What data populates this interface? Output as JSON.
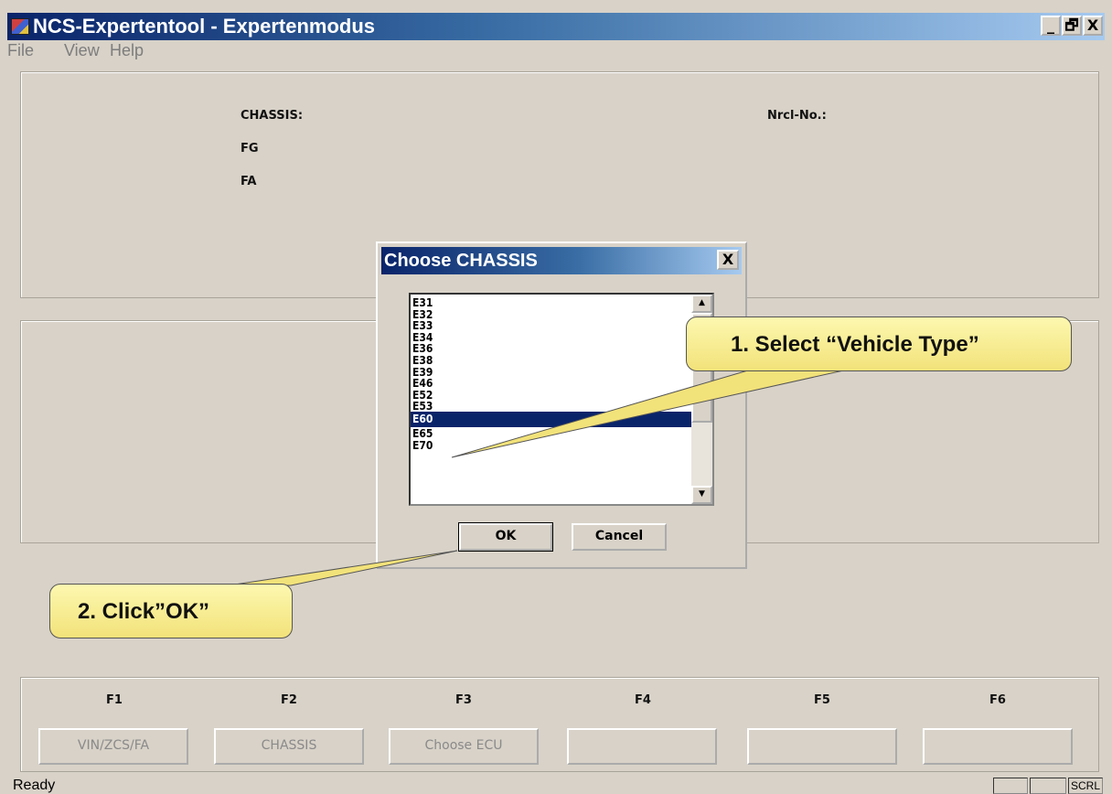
{
  "window": {
    "title": "NCS-Expertentool - Expertenmodus",
    "minimize": "_",
    "restore": "🗗",
    "close": "X"
  },
  "menu": {
    "file": "File",
    "view": "View",
    "help": "Help"
  },
  "info_panel": {
    "chassis_label": "CHASSIS:",
    "fg_label": "FG",
    "fa_label": "FA",
    "nrcl_label": "Nrcl-No.:"
  },
  "dialog": {
    "title": "Choose CHASSIS",
    "close": "X",
    "items": [
      "E31",
      "E32",
      "E33",
      "E34",
      "E36",
      "E38",
      "E39",
      "E46",
      "E52",
      "E53",
      "E60",
      "E65",
      "E70"
    ],
    "selected_item": "E60",
    "ok_label": "OK",
    "cancel_label": "Cancel",
    "scroll_up": "▲",
    "scroll_down": "▼"
  },
  "function_keys": [
    {
      "key": "F1",
      "label": "VIN/ZCS/FA"
    },
    {
      "key": "F2",
      "label": "CHASSIS"
    },
    {
      "key": "F3",
      "label": "Choose ECU"
    },
    {
      "key": "F4",
      "label": ""
    },
    {
      "key": "F5",
      "label": ""
    },
    {
      "key": "F6",
      "label": ""
    }
  ],
  "status": {
    "text": "Ready",
    "indicator": "SCRL"
  },
  "callouts": {
    "step1": "1. Select “Vehicle Type”",
    "step2": "2. Click”OK”",
    "color": "#f6ea8a"
  }
}
